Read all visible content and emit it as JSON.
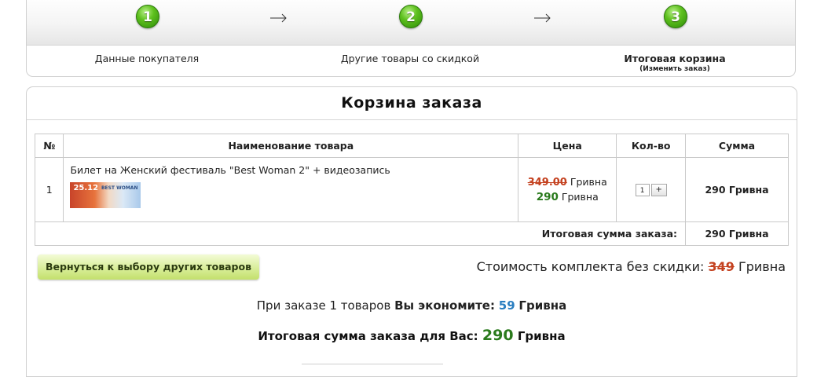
{
  "steps": [
    {
      "number": "1",
      "label": "Данные покупателя"
    },
    {
      "number": "2",
      "label": "Другие товары со скидкой"
    },
    {
      "number": "3",
      "label": "Итоговая корзина",
      "sub": "(Изменить заказ)"
    }
  ],
  "cart": {
    "title": "Корзина заказа",
    "headers": {
      "num": "№",
      "name": "Наименование товара",
      "price": "Цена",
      "qty": "Кол-во",
      "sum": "Сумма"
    },
    "items": [
      {
        "num": "1",
        "name": "Билет на Женский фестиваль \"Best Woman 2\" + видеозапись",
        "thumb_date": "25.12",
        "thumb_text": "BEST WOMAN",
        "old_price": "349.00",
        "new_price": "290",
        "currency": "Гривна",
        "qty": "1",
        "qty_plus": "+",
        "sum": "290 Гривна"
      }
    ],
    "total_label": "Итоговая сумма заказа:",
    "total_value": "290 Гривна"
  },
  "back_button": "Вернуться к выбору других товаров",
  "no_discount": {
    "label": "Стоимость комплекта без скидки:",
    "value": "349",
    "currency": "Гривна"
  },
  "economy": {
    "prefix": "При заказе 1 товаров",
    "bold": "Вы экономите:",
    "value": "59",
    "currency": "Гривна"
  },
  "final": {
    "label": "Итоговая сумма заказа для Вас:",
    "value": "290",
    "currency": "Гривна"
  },
  "colors": {
    "accent_green": "#2a7a1c",
    "strike_red": "#c4411f",
    "economy_blue": "#2a7ec0",
    "button_green": "#c3e06c"
  }
}
